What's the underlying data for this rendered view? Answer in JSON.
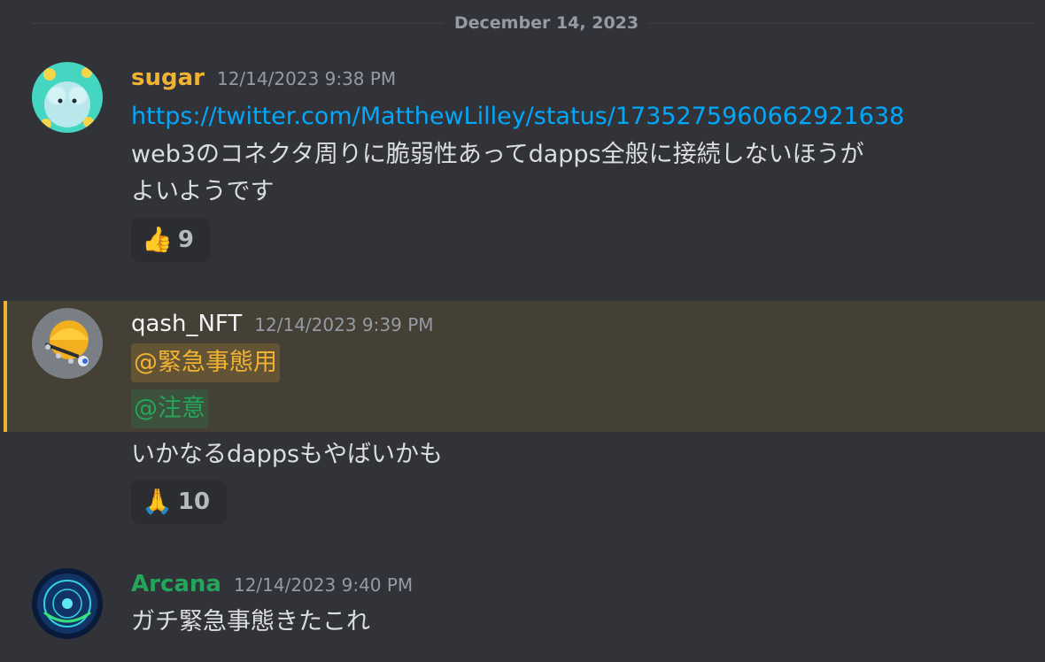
{
  "date_divider": "December 14, 2023",
  "colors": {
    "background": "#313338",
    "sugar_name": "#f0b232",
    "qash_name": "#ffffff",
    "arcana_name": "#23a55a",
    "link": "#00a8fc",
    "mention_emergency": "#f0b232",
    "mention_caution": "#23a55a",
    "highlight_bar": "#f0b232"
  },
  "messages": [
    {
      "author": "sugar",
      "timestamp": "12/14/2023 9:38 PM",
      "avatar_icon": "fluffy-creature-avatar",
      "link": "https://twitter.com/MatthewLilley/status/1735275960662921638",
      "line1": "web3のコネクタ周りに脆弱性あってdapps全般に接続しないほうが",
      "line2": "よいようです",
      "reaction": {
        "emoji": "👍",
        "count": "9"
      }
    },
    {
      "author": "qash_NFT",
      "timestamp": "12/14/2023 9:39 PM",
      "avatar_icon": "helmet-robot-avatar",
      "mention1": "@緊急事態用",
      "mention2": "@注意",
      "text": "いかなるdappsもやばいかも",
      "reaction": {
        "emoji": "🙏",
        "count": "10"
      }
    },
    {
      "author": "Arcana",
      "timestamp": "12/14/2023 9:40 PM",
      "avatar_icon": "mystic-circle-avatar",
      "text": "ガチ緊急事態きたこれ"
    }
  ]
}
